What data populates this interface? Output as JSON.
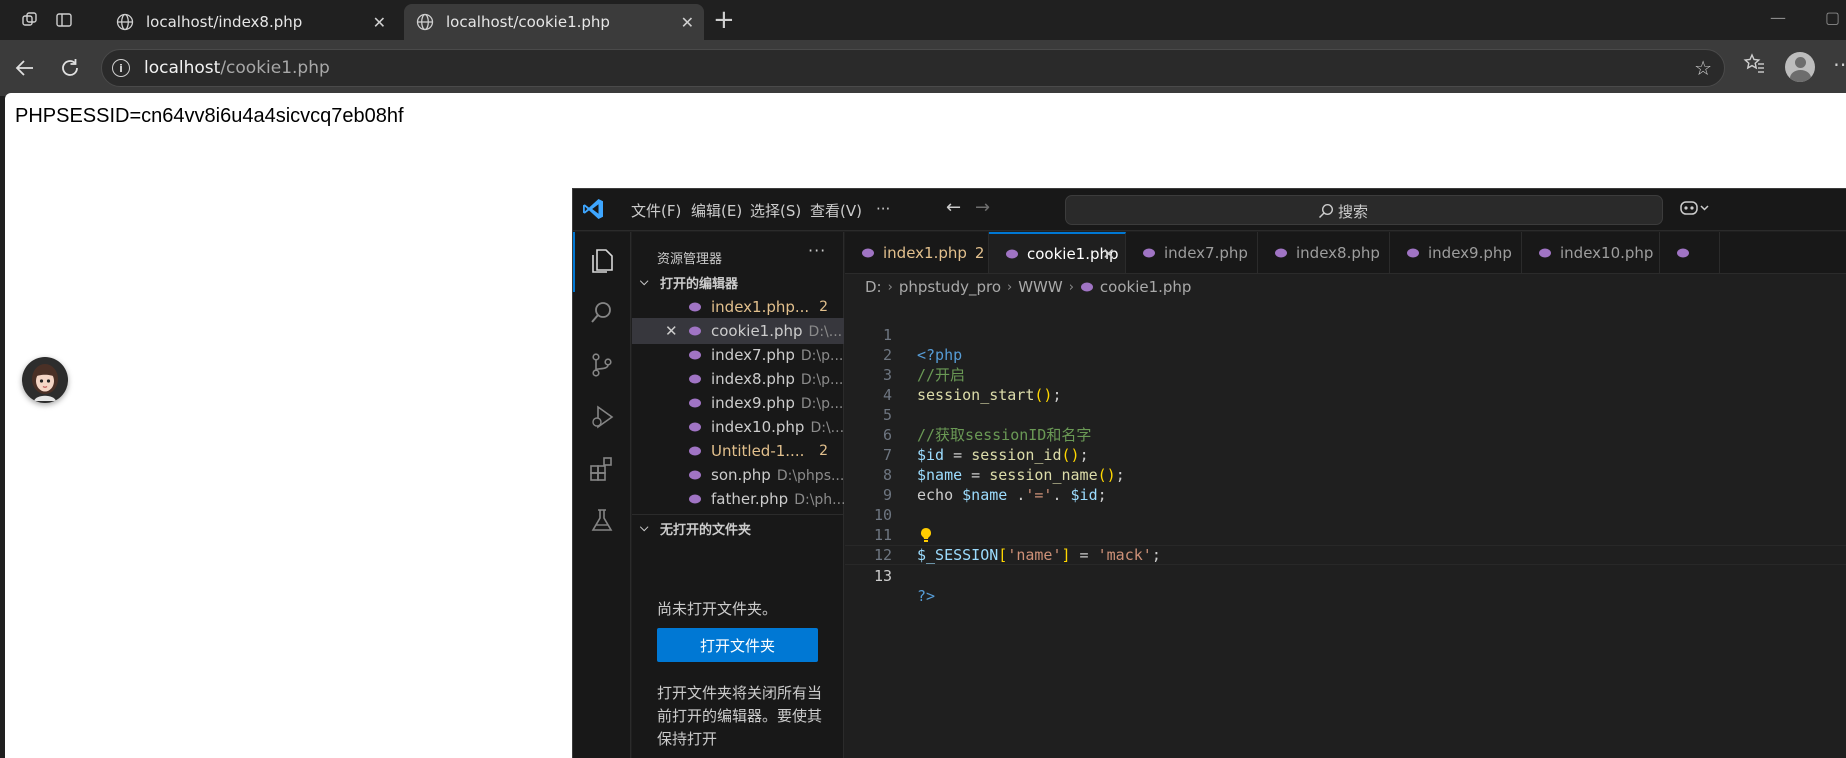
{
  "browser": {
    "tabs": [
      {
        "title": "localhost/index8.php",
        "active": false
      },
      {
        "title": "localhost/cookie1.php",
        "active": true
      }
    ],
    "address": {
      "host": "localhost",
      "path": "/cookie1.php"
    }
  },
  "page": {
    "text": "PHPSESSID=cn64vv8i6u4a4sicvcq7eb08hf"
  },
  "vscode": {
    "menu": [
      "文件(F)",
      "编辑(E)",
      "选择(S)",
      "查看(V)",
      "···"
    ],
    "search_label": "搜索",
    "sidebar": {
      "title": "资源管理器",
      "more": "···",
      "open_editors_label": "打开的编辑器",
      "open_editors": [
        {
          "name": "index1.php...",
          "path": "",
          "badge": "2",
          "modified": true
        },
        {
          "name": "cookie1.php",
          "path": "D:\\...",
          "badge": "",
          "modified": false,
          "selected": true
        },
        {
          "name": "index7.php",
          "path": "D:\\p...",
          "badge": "",
          "modified": false
        },
        {
          "name": "index8.php",
          "path": "D:\\p...",
          "badge": "",
          "modified": false
        },
        {
          "name": "index9.php",
          "path": "D:\\p...",
          "badge": "",
          "modified": false
        },
        {
          "name": "index10.php",
          "path": "D:\\...",
          "badge": "",
          "modified": false
        },
        {
          "name": "Untitled-1....",
          "path": "",
          "badge": "2",
          "modified": true
        },
        {
          "name": "son.php",
          "path": "D:\\phps...",
          "badge": "",
          "modified": false
        },
        {
          "name": "father.php",
          "path": "D:\\ph...",
          "badge": "",
          "modified": false
        }
      ],
      "no_folder_label": "无打开的文件夹",
      "no_folder_message": "尚未打开文件夹。",
      "open_folder_button": "打开文件夹",
      "description": "打开文件夹将关闭所有当前打开的编辑器。要使其保持打开"
    },
    "tabs": [
      {
        "label": "index1.php",
        "badge": "2",
        "modified": true,
        "active": false
      },
      {
        "label": "cookie1.php",
        "badge": "",
        "modified": false,
        "active": true
      },
      {
        "label": "index7.php",
        "badge": "",
        "modified": false,
        "active": false
      },
      {
        "label": "index8.php",
        "badge": "",
        "modified": false,
        "active": false
      },
      {
        "label": "index9.php",
        "badge": "",
        "modified": false,
        "active": false
      },
      {
        "label": "index10.php",
        "badge": "",
        "modified": false,
        "active": false
      }
    ],
    "breadcrumb": [
      "D:",
      "phpstudy_pro",
      "WWW",
      "cookie1.php"
    ],
    "line_numbers": [
      "1",
      "2",
      "3",
      "4",
      "5",
      "6",
      "7",
      "8",
      "9",
      "10",
      "11",
      "12",
      "13"
    ],
    "current_line": "13",
    "code": {
      "l1": "<?php",
      "l2": "//开启",
      "l3_fn": "session_start",
      "l5": "//获取sessionID和名字",
      "l6_var": "$id",
      "l6_fn": "session_id",
      "l7_var": "$name",
      "l7_fn": "session_name",
      "l8_kw": "echo",
      "l8_var1": "$name",
      "l8_str": "'='",
      "l8_var2": "$id",
      "l11_var": "$_SESSION",
      "l11_key": "'name'",
      "l11_val": "'mack'",
      "l13": "?>"
    }
  }
}
